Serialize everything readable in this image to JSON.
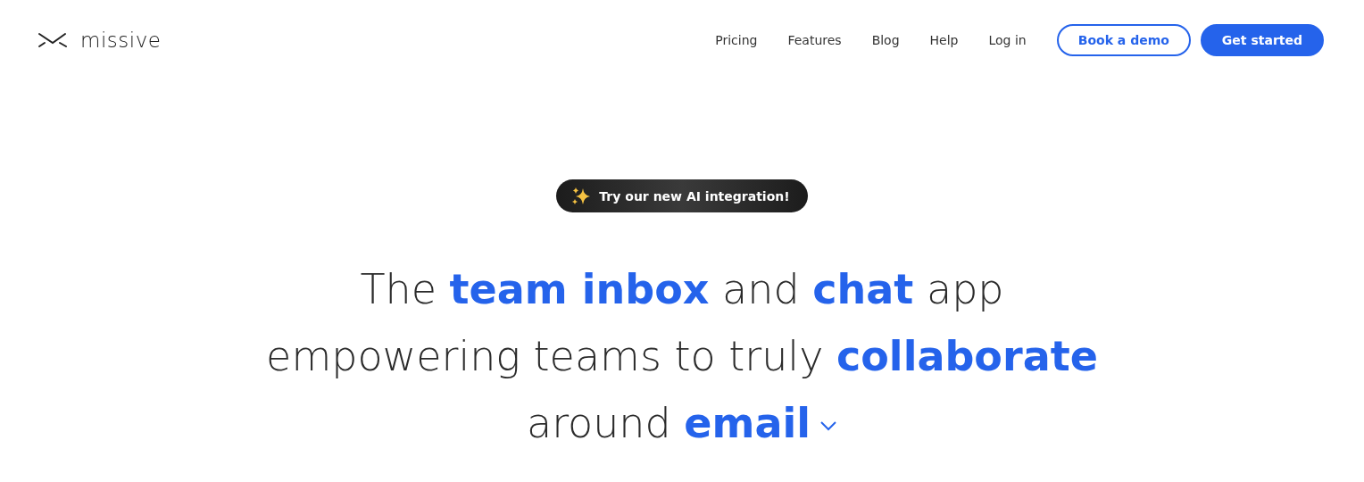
{
  "header": {
    "logo_text": "missive",
    "nav": [
      "Pricing",
      "Features",
      "Blog",
      "Help",
      "Log in"
    ],
    "buttons": [
      {
        "label": "Book a demo",
        "kind": "outline"
      },
      {
        "label": "Get started",
        "kind": "solid"
      }
    ]
  },
  "hero": {
    "badge": "Try our new AI integration!",
    "headline_lines": [
      "The **team inbox** and **chat** app",
      "empowering teams to truly **collaborate**",
      "around **email**"
    ]
  }
}
